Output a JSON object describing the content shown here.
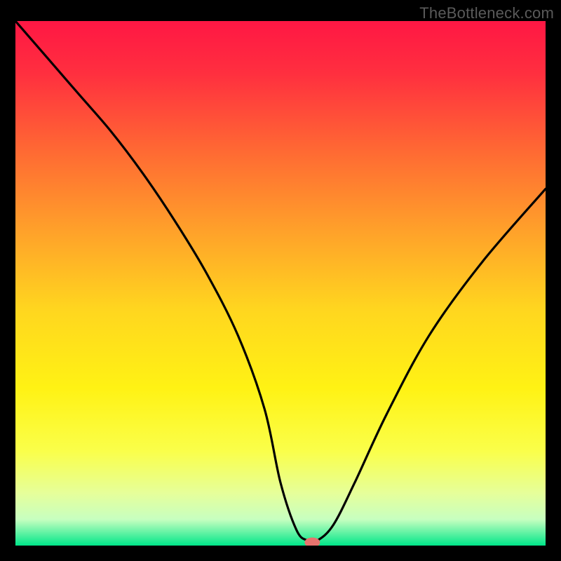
{
  "watermark": "TheBottleneck.com",
  "chart_data": {
    "type": "line",
    "title": "",
    "xlabel": "",
    "ylabel": "",
    "xlim": [
      0,
      100
    ],
    "ylim": [
      0,
      100
    ],
    "background_gradient": {
      "stops": [
        {
          "offset": 0.0,
          "color": "#ff1744"
        },
        {
          "offset": 0.1,
          "color": "#ff2f3f"
        },
        {
          "offset": 0.25,
          "color": "#ff6a33"
        },
        {
          "offset": 0.4,
          "color": "#ffa12a"
        },
        {
          "offset": 0.55,
          "color": "#ffd61f"
        },
        {
          "offset": 0.7,
          "color": "#fff214"
        },
        {
          "offset": 0.82,
          "color": "#faff4a"
        },
        {
          "offset": 0.9,
          "color": "#e6ff9a"
        },
        {
          "offset": 0.95,
          "color": "#c7ffc0"
        },
        {
          "offset": 1.0,
          "color": "#00e689"
        }
      ]
    },
    "series": [
      {
        "name": "bottleneck-curve",
        "x": [
          0,
          6,
          12,
          18,
          24,
          30,
          36,
          42,
          47,
          50,
          53,
          55,
          57,
          60,
          64,
          70,
          78,
          88,
          100
        ],
        "y": [
          100,
          93,
          86,
          79,
          71,
          62,
          52,
          40,
          26,
          12,
          3,
          1,
          1,
          4,
          12,
          25,
          40,
          54,
          68
        ]
      }
    ],
    "marker": {
      "x": 56,
      "y": 0.6,
      "color": "#e7736e"
    }
  }
}
